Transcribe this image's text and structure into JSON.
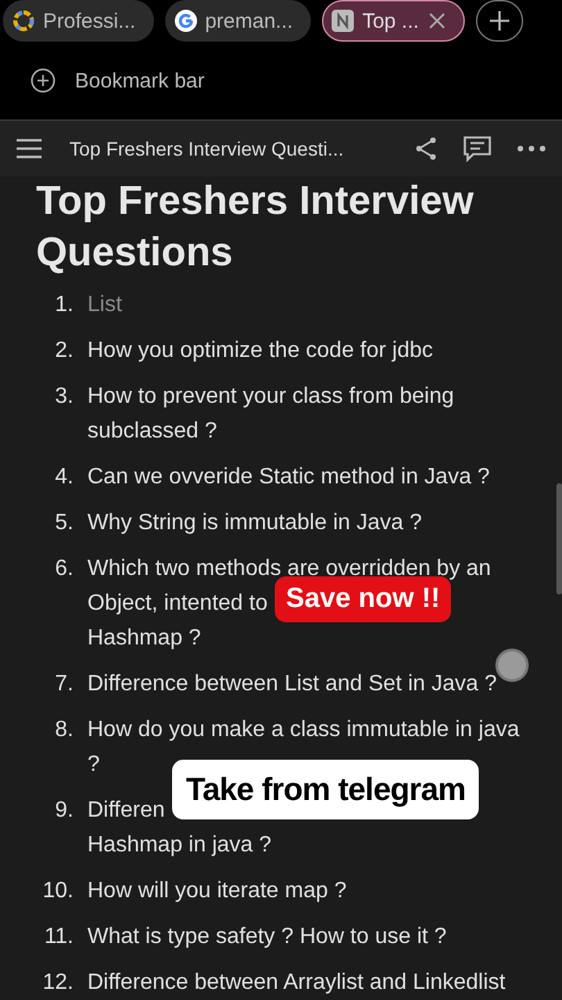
{
  "tabs": [
    {
      "label": "Professi...",
      "selected": false
    },
    {
      "label": "preman...",
      "selected": false
    },
    {
      "label": "Top ...",
      "selected": true
    }
  ],
  "bookmark_bar": {
    "label": "Bookmark bar"
  },
  "header": {
    "title": "Top Freshers Interview Questi..."
  },
  "page": {
    "heading": "Top Freshers Interview Questions",
    "items": [
      {
        "number": "1.",
        "lines": [
          "List"
        ],
        "placeholder": true
      },
      {
        "number": "2.",
        "lines": [
          "How you optimize the code for jdbc"
        ],
        "placeholder": false
      },
      {
        "number": "3.",
        "lines": [
          "How to prevent your class from being",
          "subclassed ?"
        ],
        "placeholder": false
      },
      {
        "number": "4.",
        "lines": [
          "Can we ovveride Static method in Java ?"
        ],
        "placeholder": false
      },
      {
        "number": "5.",
        "lines": [
          "Why String is immutable in Java ?"
        ],
        "placeholder": false
      },
      {
        "number": "6.",
        "lines": [
          "Which two methods are overridden by an",
          "Object, intented to",
          "Hashmap ?"
        ],
        "placeholder": false
      },
      {
        "number": "7.",
        "lines": [
          "Difference between List and Set in Java ?"
        ],
        "placeholder": false
      },
      {
        "number": "8.",
        "lines": [
          "How do you make a class immutable in java",
          "?"
        ],
        "placeholder": false
      },
      {
        "number": "9.",
        "lines": [
          "Differen",
          "Hashmap in java ?"
        ],
        "placeholder": false
      },
      {
        "number": "10.",
        "lines": [
          "How will you iterate map ?"
        ],
        "placeholder": false
      },
      {
        "number": "11.",
        "lines": [
          "What is type safety ? How to use it ?"
        ],
        "placeholder": false
      },
      {
        "number": "12.",
        "lines": [
          "Difference between Arraylist and Linkedlist"
        ],
        "placeholder": false
      }
    ]
  },
  "stickers": [
    {
      "text": "Save now !!",
      "kind": "red"
    },
    {
      "text": "Take from telegram",
      "kind": "white"
    }
  ]
}
